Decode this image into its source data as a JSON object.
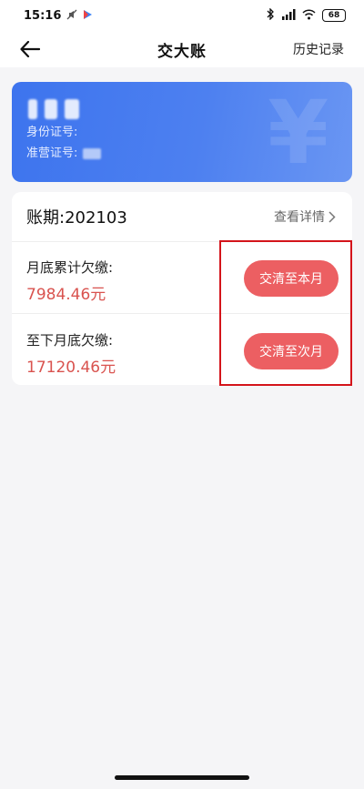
{
  "status_bar": {
    "time": "15:16",
    "left_icons": [
      "mute-icon",
      "play-store-icon"
    ],
    "right_icons": [
      "bluetooth-icon",
      "signal-icon",
      "wifi-icon"
    ],
    "battery": "68"
  },
  "nav": {
    "title": "交大账",
    "history_label": "历史记录"
  },
  "id_card": {
    "id_label": "身份证号:",
    "license_label": "准营证号:",
    "background_symbol": "¥",
    "colors": {
      "start": "#3d74ee",
      "end": "#6a96f3"
    }
  },
  "bill": {
    "period": "账期:202103",
    "detail_label": "查看详情",
    "rows": [
      {
        "label": "月底累计欠缴:",
        "amount": "7984.46元",
        "button": "交清至本月"
      },
      {
        "label": "至下月底欠缴:",
        "amount": "17120.46元",
        "button": "交清至次月"
      }
    ]
  },
  "colors": {
    "accent_button": "#ec5f62",
    "amount_text": "#d9534f",
    "highlight": "#d4141b"
  }
}
